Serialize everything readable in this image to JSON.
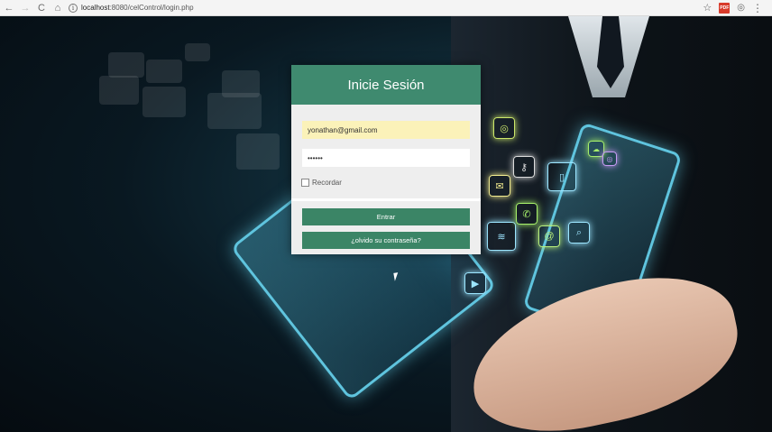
{
  "browser": {
    "url_host": "localhost",
    "url_path": ":8080/celControl/login.php",
    "back_icon": "←",
    "forward_icon": "→",
    "reload_icon": "C",
    "home_icon": "⌂",
    "info_icon": "i",
    "star_icon": "☆",
    "pdf_label": "PDF",
    "camera_icon": "◎",
    "menu_icon": "⋮"
  },
  "login": {
    "title": "Inicie Sesión",
    "email_value": "yonathan@gmail.com",
    "password_value": "••••••",
    "remember_label": "Recordar",
    "submit_label": "Entrar",
    "forgot_label": "¿olvido su contraseña?"
  },
  "colors": {
    "header": "#3f8a6f",
    "button": "#3b8566",
    "email_bg": "#fbf2b9"
  }
}
